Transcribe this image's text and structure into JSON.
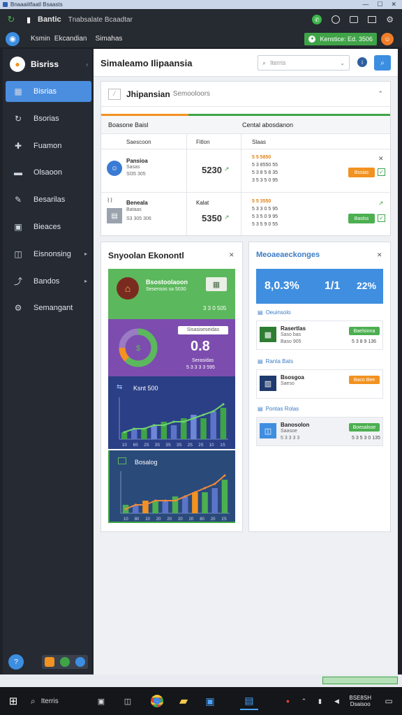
{
  "window": {
    "title": "Bnaaaiitfaatl Bsaasts",
    "min": "—",
    "max": "☐",
    "close": "✕"
  },
  "header": {
    "app_name": "Bantic",
    "app_subtitle": "Tnabsalate Bcaadtar",
    "nav": [
      "Ksmin",
      "Ekcandian",
      "Simahas"
    ],
    "account_label": "Kenstice: Ed. 3506"
  },
  "sidebar": {
    "title": "Bisriss",
    "items": [
      {
        "label": "Bisrias",
        "icon": "dashboard-icon",
        "active": true,
        "arrow": false
      },
      {
        "label": "Bsorias",
        "icon": "refresh-icon",
        "active": false,
        "arrow": false
      },
      {
        "label": "Fuamon",
        "icon": "puzzle-icon",
        "active": false,
        "arrow": false
      },
      {
        "label": "Olsaoon",
        "icon": "folder-icon",
        "active": false,
        "arrow": false
      },
      {
        "label": "Besarilas",
        "icon": "pen-icon",
        "active": false,
        "arrow": false
      },
      {
        "label": "Bieaces",
        "icon": "box-icon",
        "active": false,
        "arrow": false
      },
      {
        "label": "Eisnonsing",
        "icon": "cube-icon",
        "active": false,
        "arrow": true
      },
      {
        "label": "Bandos",
        "icon": "link-icon",
        "active": false,
        "arrow": true
      },
      {
        "label": "Semangant",
        "icon": "gear-icon",
        "active": false,
        "arrow": false
      }
    ]
  },
  "page": {
    "title": "Simaleamo Ilipaansia",
    "search_placeholder": "Iterris"
  },
  "table_card": {
    "title": "Jhipansian",
    "subtitle": "Semooloors",
    "col_group_left": "Boasone Baisl",
    "col_group_right": "Cental abosdanon",
    "headers": [
      "Saescoon",
      "Fitlon",
      "Slaas"
    ],
    "rows": [
      {
        "name": "Pansioa",
        "sub": "Sasas",
        "meta": "Sl35 305",
        "value": "5230",
        "vals": [
          "5 5 5850",
          "5 3 8550 55",
          "5 3 8 5 8 35",
          "3 5 3 5 0 95"
        ],
        "btn": "Bssias",
        "btn_color": "orange"
      },
      {
        "name": "Beneala",
        "sub": "Bataas",
        "meta": "S3 305 306",
        "col2": "Kalat",
        "value": "5350",
        "vals": [
          "5 5 3550",
          "5 3 3 0 5 95",
          "5 3 5 0 9 95",
          "5 3 5 9 0 55"
        ],
        "btn": "Baslss",
        "btn_color": "green"
      }
    ]
  },
  "econ_card": {
    "title": "Snyoolan Ekonontl",
    "tile1": {
      "title": "Bsostoolaoon",
      "sub": "Sesensos sa 5030",
      "value": "3 3 0 505"
    },
    "tile2": {
      "label": "Sisasiseseidas",
      "value": "0.8",
      "sub": "Serasidas",
      "foot": "5 3 3 3 3 595"
    },
    "tile3": {
      "label": "Ksnt 500"
    },
    "tile4": {
      "label": "Bosalog"
    }
  },
  "msg_card": {
    "title": "Meoaeaeckonges",
    "stats": [
      "8,0.3%",
      "1/1",
      "22%"
    ],
    "sections": [
      {
        "heading": "Oeuinsolo",
        "name": "Rasertlas",
        "sub": "Saso bas",
        "meta": "Baso 905",
        "badge": "Baelsiona",
        "badge_color": "green",
        "value": "5 3 8 9 136",
        "icon": "cash-icon"
      },
      {
        "heading": "Ranta Bats",
        "name": "Bsosgoa",
        "sub": "Saeso",
        "meta": "",
        "badge": "Baco Bee",
        "badge_color": "orange",
        "value": "",
        "icon": "book-icon"
      },
      {
        "heading": "Pontas Rolas",
        "name": "Banosolon",
        "sub": "Saasoe",
        "meta": "5 3 3 3 3",
        "badge": "Boesalsoe",
        "badge_color": "green",
        "value": "5 3 5 3 0 135",
        "icon": "cube-icon"
      }
    ]
  },
  "chart_data": [
    {
      "type": "bar",
      "title": "Ksnt 500",
      "categories": [
        "1",
        "2",
        "3",
        "4",
        "5",
        "6",
        "7",
        "8",
        "9",
        "10",
        "11"
      ],
      "series": [
        {
          "values": [
            2,
            3,
            3,
            4,
            5,
            4,
            6,
            7,
            6,
            8,
            9
          ]
        },
        {
          "values": [
            2,
            3,
            3,
            4,
            4,
            5,
            5,
            6,
            7,
            8,
            10
          ]
        }
      ],
      "tick_labels": [
        "10",
        "6S",
        "2S",
        "3S",
        "3S",
        "3S",
        "2S",
        "2S",
        "10",
        "1S"
      ],
      "ylim": [
        0,
        12
      ]
    },
    {
      "type": "bar",
      "title": "Bosalog",
      "categories": [
        "1",
        "2",
        "3",
        "4",
        "5",
        "6",
        "7",
        "8",
        "9",
        "10",
        "11"
      ],
      "series": [
        {
          "values": [
            2,
            2,
            3,
            3,
            3,
            4,
            4,
            5,
            5,
            6,
            8
          ]
        },
        {
          "values": [
            1,
            2,
            2,
            3,
            3,
            3,
            4,
            5,
            6,
            7,
            9
          ]
        }
      ],
      "tick_labels": [
        "10",
        "80",
        "10",
        "20",
        "20",
        "20",
        "20",
        "80",
        "20",
        "2S"
      ],
      "ylim": [
        0,
        10
      ]
    }
  ],
  "taskbar": {
    "search_label": "Iterris",
    "clock": "BSE8SH",
    "date": "Dsaisoo"
  },
  "colors": {
    "accent": "#4b8ee0",
    "green": "#4caf50",
    "orange": "#f29220",
    "purple": "#7e57c2",
    "navy": "#2b3f86"
  }
}
